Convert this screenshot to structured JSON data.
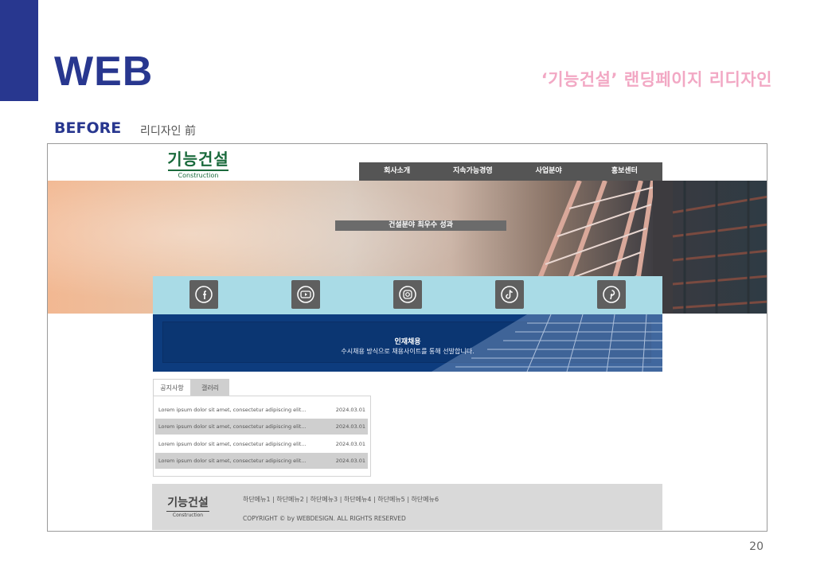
{
  "slide": {
    "title": "WEB",
    "subtitle": "‘기능건설’ 랜딩페이지 리디자인",
    "section_label": "BEFORE",
    "section_note": "리디자인 前",
    "page_number": "20",
    "colors": {
      "accent": "#28378f",
      "subtitle": "#f2a8c4"
    }
  },
  "site": {
    "logo": {
      "name": "기능건설",
      "tagline": "Construction",
      "color": "#1a6a3c"
    },
    "nav": [
      "회사소개",
      "지속가능경영",
      "사업분야",
      "홍보센터"
    ],
    "hero_caption": "건설분야 최우수 성과",
    "social_icons": [
      "facebook-icon",
      "youtube-icon",
      "instagram-icon",
      "tiktok-icon",
      "pinterest-icon"
    ],
    "recruit": {
      "title": "인재채용",
      "desc": "수시채용 방식으로 채용사이트를 통해 선발합니다."
    },
    "board": {
      "tabs": [
        "공지사항",
        "갤러리"
      ],
      "rows": [
        {
          "title": "Lorem ipsum dolor sit amet, consectetur adipiscing elit...",
          "date": "2024.03.01"
        },
        {
          "title": "Lorem ipsum dolor sit amet, consectetur adipiscing elit...",
          "date": "2024.03.01"
        },
        {
          "title": "Lorem ipsum dolor sit amet, consectetur adipiscing elit...",
          "date": "2024.03.01"
        },
        {
          "title": "Lorem ipsum dolor sit amet, consectetur adipiscing elit...",
          "date": "2024.03.01"
        }
      ]
    },
    "footer": {
      "logo_name": "기능건설",
      "logo_tagline": "Construction",
      "links": "하단메뉴1 | 하단메뉴2 | 하단메뉴3 | 하단메뉴4 | 하단메뉴5 | 하단메뉴6",
      "copyright": "COPYRIGHT © by WEBDESIGN. ALL RIGHTS RESERVED"
    }
  }
}
